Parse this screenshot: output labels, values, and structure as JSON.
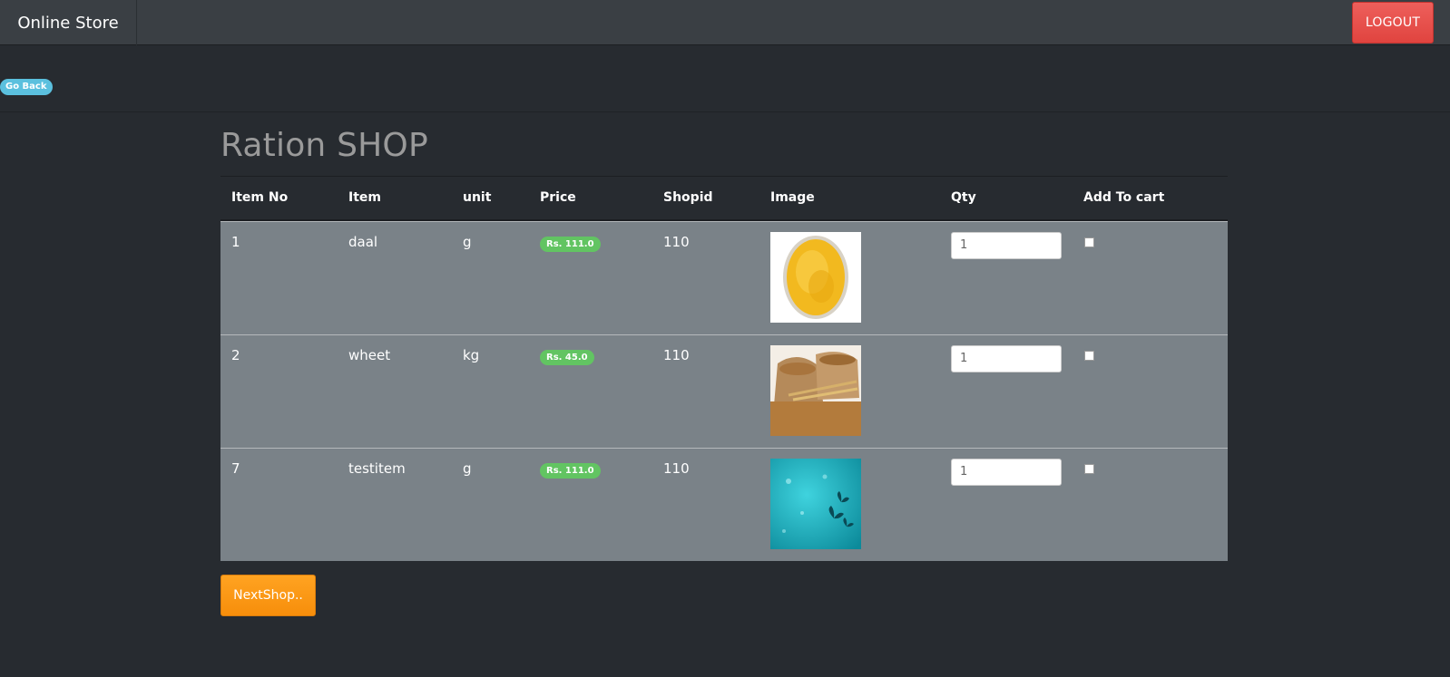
{
  "navbar": {
    "brand": "Online Store",
    "logout_label": "LOGOUT"
  },
  "go_back_label": "Go Back",
  "page_title": "Ration SHOP",
  "table": {
    "headers": [
      "Item No",
      "Item",
      "unit",
      "Price",
      "Shopid",
      "Image",
      "Qty",
      "Add To cart"
    ],
    "rows": [
      {
        "item_no": "1",
        "item": "daal",
        "unit": "g",
        "price": "Rs. 111.0",
        "shopid": "110",
        "qty": "1",
        "add_to_cart": false,
        "image": "daal-image"
      },
      {
        "item_no": "2",
        "item": "wheet",
        "unit": "kg",
        "price": "Rs. 45.0",
        "shopid": "110",
        "qty": "1",
        "add_to_cart": false,
        "image": "wheat-sack-image"
      },
      {
        "item_no": "7",
        "item": "testitem",
        "unit": "g",
        "price": "Rs. 111.0",
        "shopid": "110",
        "qty": "1",
        "add_to_cart": false,
        "image": "teal-butterflies-image"
      }
    ]
  },
  "next_shop_label": "NextShop..",
  "colors": {
    "background": "#272b30",
    "navbar": "#3a3f44",
    "row": "#7a8288",
    "danger": "#ee5f5b",
    "info": "#5bc0de",
    "success": "#62c462",
    "warning": "#f89406"
  }
}
